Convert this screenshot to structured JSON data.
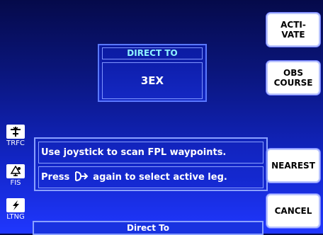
{
  "softkeys": {
    "activate": "ACTI-\nVATE",
    "obs_course": "OBS\nCOURSE",
    "nearest": "NEAREST",
    "cancel": "CANCEL"
  },
  "direct_to": {
    "title": "DIRECT TO",
    "waypoint": "3EX"
  },
  "side_icons": [
    {
      "label": "TRFC",
      "icon": "traffic-icon"
    },
    {
      "label": "FIS",
      "icon": "weather-icon"
    },
    {
      "label": "LTNG",
      "icon": "lightning-icon"
    }
  ],
  "message": {
    "line1": "Use joystick to scan FPL waypoints.",
    "line2_pre": "Press",
    "line2_post": "again to select active leg."
  },
  "status_bar": {
    "title": "Direct To"
  },
  "colors": {
    "background": "#0a157a",
    "accent_text": "#8ef2ff",
    "softkey_bg": "#ffffff"
  }
}
